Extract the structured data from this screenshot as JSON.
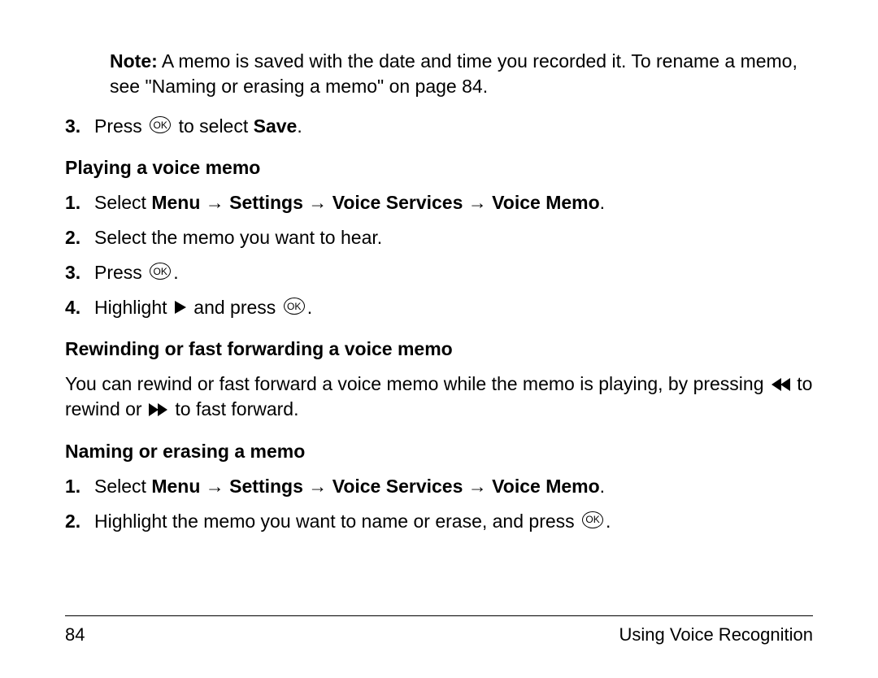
{
  "note": {
    "label": "Note:",
    "text": " A memo is saved with the date and time you recorded it. To rename a memo, see \"Naming or erasing a memo\" on page 84."
  },
  "save_step": {
    "num": "3.",
    "press": "Press ",
    "to_select": " to select ",
    "save": "Save",
    "period": "."
  },
  "section1": {
    "heading": "Playing a voice memo",
    "s1": {
      "num": "1.",
      "select": "Select ",
      "menu": "Menu",
      "arr": " → ",
      "settings": "Settings",
      "voice_services": "Voice Services",
      "voice_memo": "Voice Memo",
      "period": "."
    },
    "s2": {
      "num": "2.",
      "text": "Select the memo you want to hear."
    },
    "s3": {
      "num": "3.",
      "press": "Press ",
      "period": "."
    },
    "s4": {
      "num": "4.",
      "highlight": "Highlight ",
      "and_press": " and press ",
      "period": "."
    }
  },
  "section2": {
    "heading": "Rewinding or fast forwarding a voice memo",
    "p1": "You can rewind or fast forward a voice memo while the memo is playing, by pressing ",
    "p2": " to rewind or ",
    "p3": " to fast forward."
  },
  "section3": {
    "heading": "Naming or erasing a memo",
    "s1": {
      "num": "1.",
      "select": "Select ",
      "menu": "Menu",
      "arr": " → ",
      "settings": "Settings",
      "voice_services": "Voice Services",
      "voice_memo": "Voice Memo",
      "period": "."
    },
    "s2": {
      "num": "2.",
      "text": "Highlight the memo you want to name or erase, and press ",
      "period": "."
    }
  },
  "footer": {
    "page": "84",
    "title": "Using Voice Recognition"
  },
  "icons": {
    "ok": "OK"
  }
}
